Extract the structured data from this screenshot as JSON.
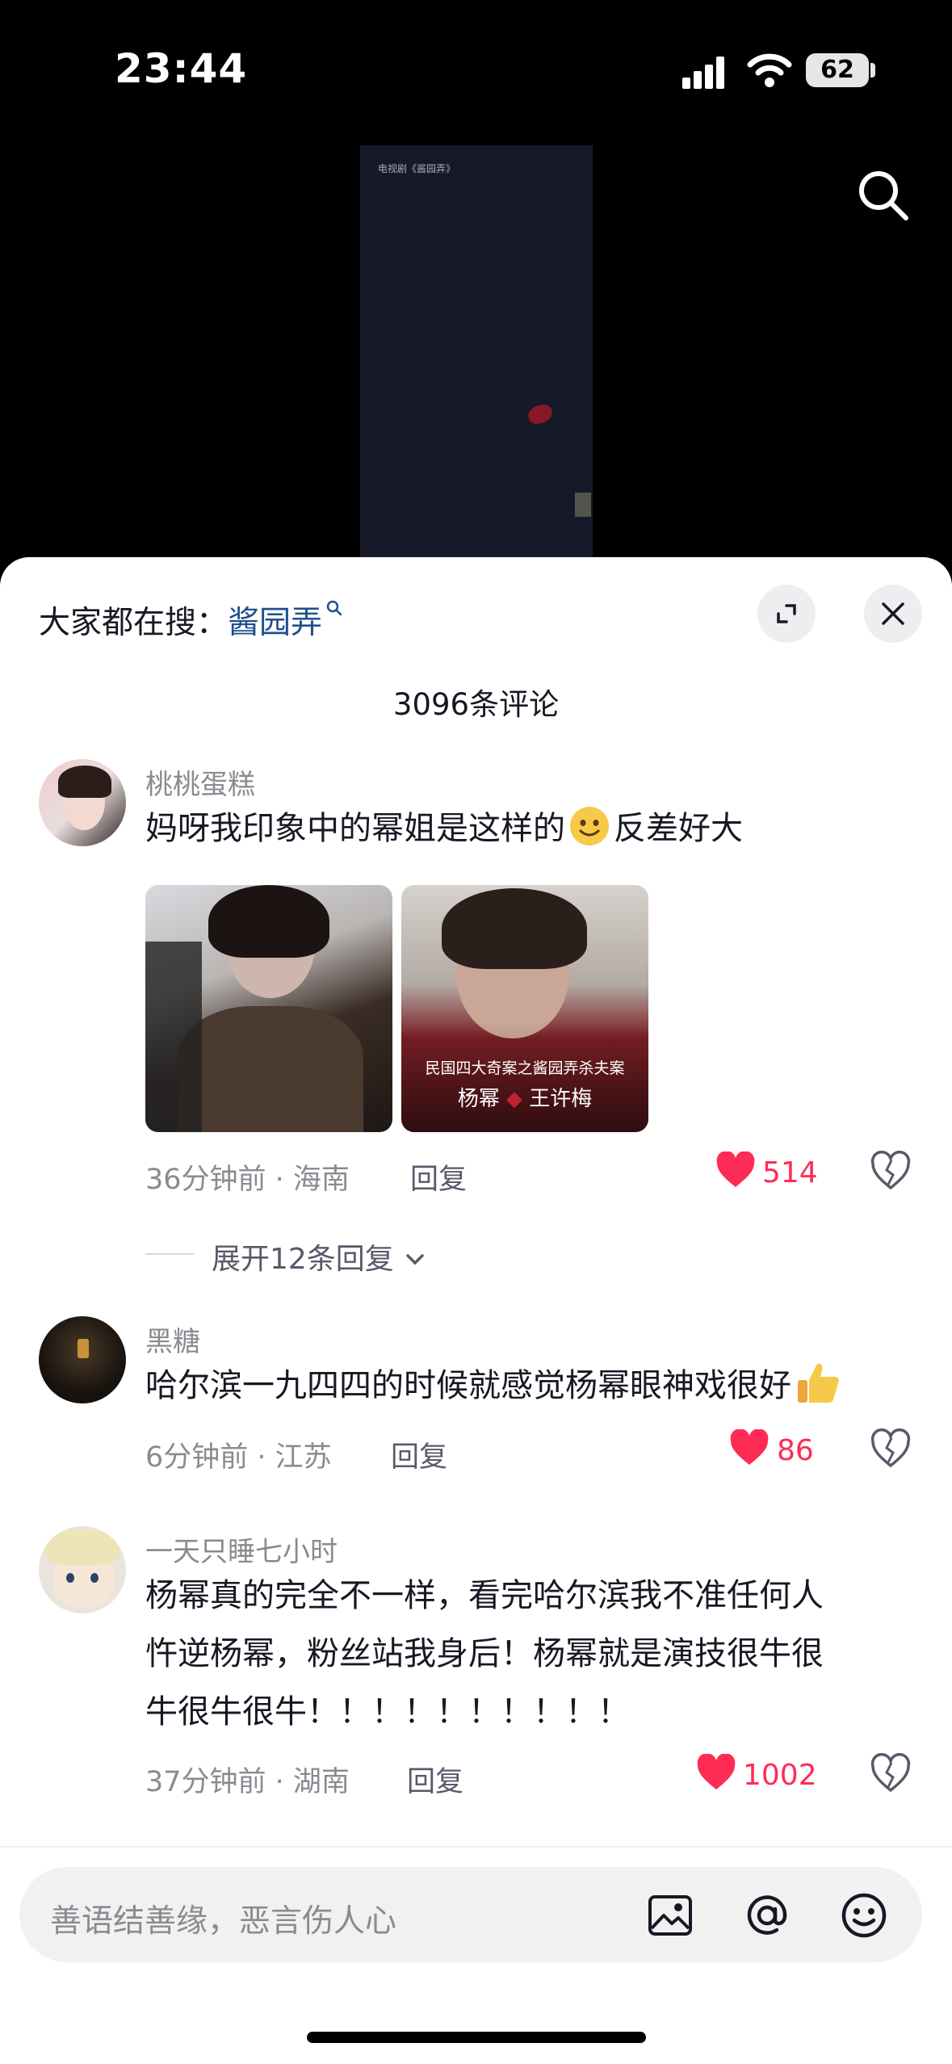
{
  "status_bar": {
    "time": "23:44",
    "battery": "62"
  },
  "video": {
    "caption": "电视剧《酱园弄》"
  },
  "sheet": {
    "search_hint_label": "大家都在搜：",
    "search_hint_keyword": "酱园弄",
    "comment_count": "3096条评论"
  },
  "comments": [
    {
      "username": "桃桃蛋糕",
      "text": "妈呀我印象中的幂姐是这样的",
      "text_after_emoji": "反差好大",
      "images": [
        {
          "caption": ""
        },
        {
          "caption_line1": "民国四大奇案之酱园弄杀夫案",
          "caption_line2_a": "杨幂",
          "caption_line2_b": "王许梅"
        }
      ],
      "time_location": "36分钟前 · 海南",
      "reply_label": "回复",
      "likes": "514",
      "expand_replies": "展开12条回复"
    },
    {
      "username": "黑糖",
      "text": "哈尔滨一九四四的时候就感觉杨幂眼神戏很好",
      "time_location": "6分钟前 · 江苏",
      "reply_label": "回复",
      "likes": "86"
    },
    {
      "username": "一天只睡七小时",
      "text_line1": "杨幂真的完全不一样，看完哈尔滨我不准任何人",
      "text_line2": "忤逆杨幂，粉丝站我身后！杨幂就是演技很牛很",
      "text_line3": "牛很牛很牛！！！！！！！！！！",
      "time_location": "37分钟前 · 湖南",
      "reply_label": "回复",
      "likes": "1002"
    }
  ],
  "input": {
    "placeholder": "善语结善缘，恶言伤人心"
  },
  "colors": {
    "like_red": "#fe2c55",
    "keyword_blue": "#1f4e8c",
    "meta_gray": "#8a8b91"
  },
  "icons": [
    "signal-icon",
    "wifi-icon",
    "battery-icon",
    "search-icon",
    "expand-icon",
    "close-icon",
    "heart-icon",
    "dislike-icon",
    "chevron-down-icon",
    "image-icon",
    "at-icon",
    "emoji-icon"
  ]
}
